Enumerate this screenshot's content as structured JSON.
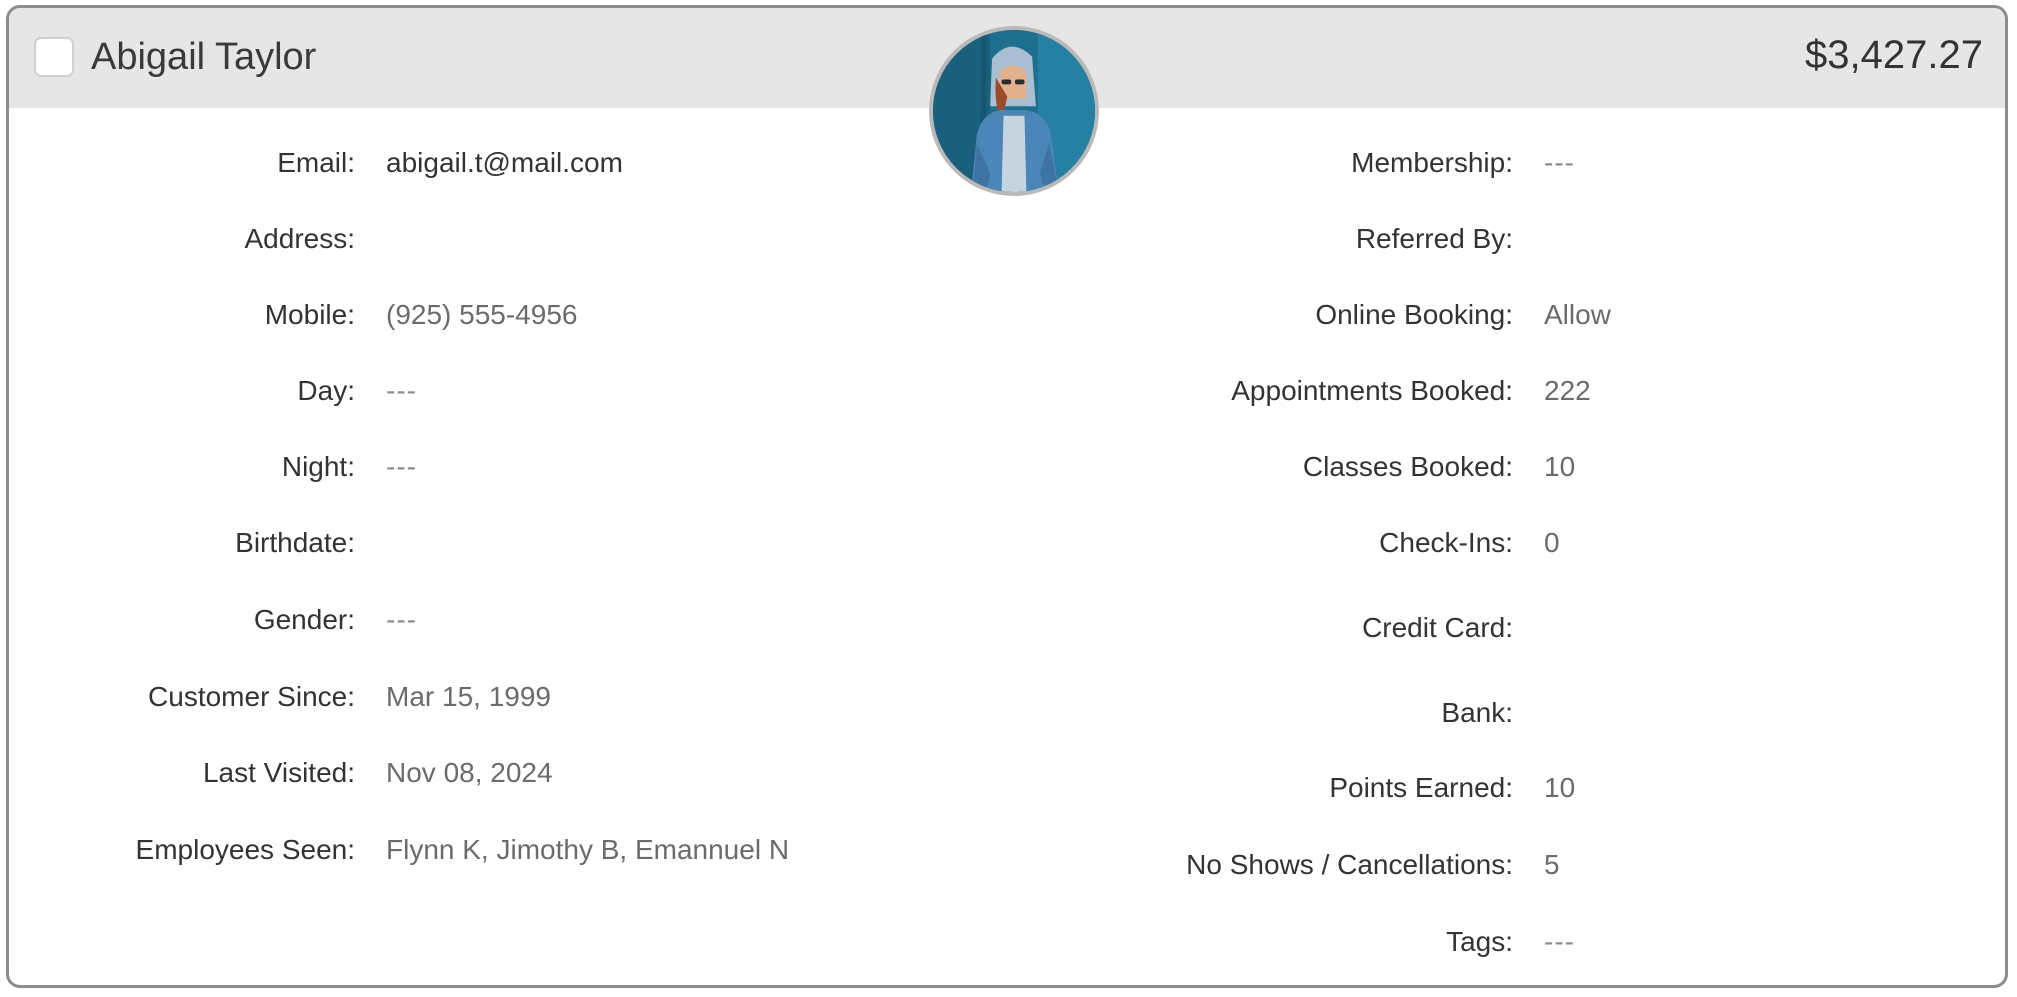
{
  "header": {
    "customer_name": "Abigail Taylor",
    "balance": "$3,427.27"
  },
  "left_fields": [
    {
      "label": "Email:",
      "value": "abigail.t@mail.com"
    },
    {
      "label": "Address:",
      "value": ""
    },
    {
      "label": "Mobile:",
      "value": "(925) 555-4956"
    },
    {
      "label": "Day:",
      "value": "---"
    },
    {
      "label": "Night:",
      "value": "---"
    },
    {
      "label": "Birthdate:",
      "value": ""
    },
    {
      "label": "Gender:",
      "value": "---"
    },
    {
      "label": "Customer Since:",
      "value": "Mar 15, 1999"
    },
    {
      "label": "Last Visited:",
      "value": "Nov 08, 2024"
    },
    {
      "label": "Employees Seen:",
      "value": "Flynn K, Jimothy B, Emannuel N"
    }
  ],
  "right_fields": [
    {
      "label": "Membership:",
      "value": "---"
    },
    {
      "label": "Referred By:",
      "value": ""
    },
    {
      "label": "Online Booking:",
      "value": "Allow"
    },
    {
      "label": "Appointments Booked:",
      "value": "222"
    },
    {
      "label": "Classes Booked:",
      "value": "10"
    },
    {
      "label": "Check-Ins:",
      "value": "0"
    },
    {
      "label": "Credit Card:",
      "value": ""
    },
    {
      "label": "Bank:",
      "value": ""
    },
    {
      "label": "Points Earned:",
      "value": "10"
    },
    {
      "label": "No Shows / Cancellations:",
      "value": "5"
    },
    {
      "label": "Tags:",
      "value": "---"
    }
  ],
  "icons": {
    "avatar": "customer-photo",
    "checkbox": "select-checkbox"
  },
  "colors": {
    "header_bg": "#e6e6e6",
    "label": "#333333",
    "value": "#6b6b6b",
    "border": "#8c8c8c"
  }
}
